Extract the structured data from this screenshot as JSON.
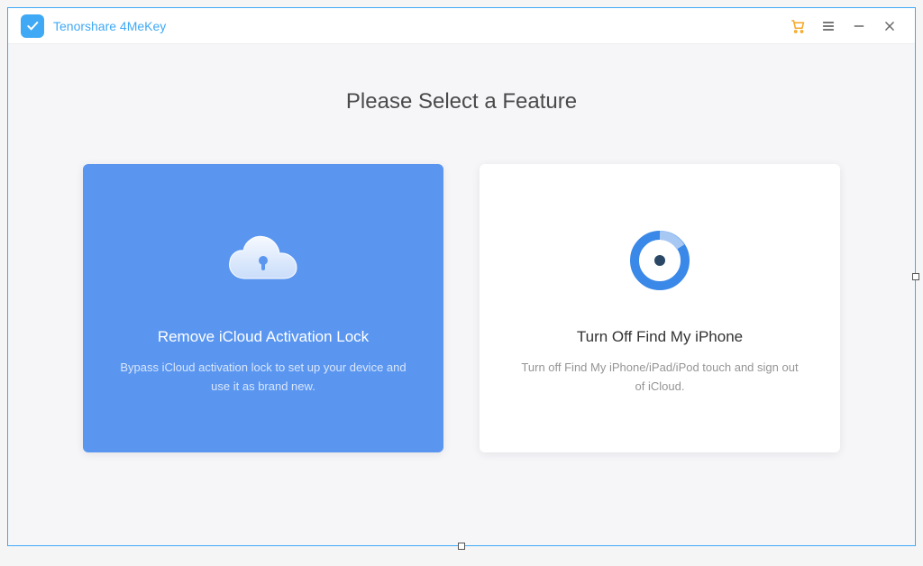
{
  "app": {
    "title": "Tenorshare 4MeKey"
  },
  "main": {
    "heading": "Please Select a Feature"
  },
  "features": {
    "remove_icloud": {
      "title": "Remove iCloud Activation Lock",
      "desc": "Bypass iCloud activation lock to set up your device and use it as brand new."
    },
    "turn_off_fmi": {
      "title": "Turn Off Find My iPhone",
      "desc": "Turn off Find My iPhone/iPad/iPod touch and sign out of iCloud."
    }
  },
  "colors": {
    "accent": "#5a96f0",
    "brand": "#3fa9f5",
    "cart": "#f5a623"
  }
}
